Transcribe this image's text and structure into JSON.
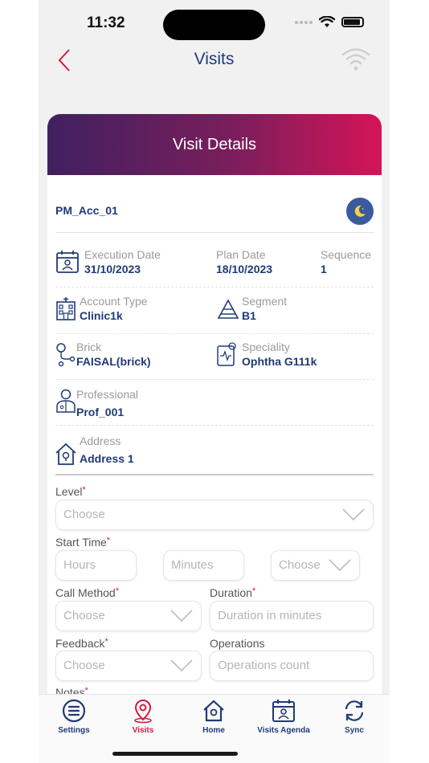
{
  "status": {
    "time": "11:32"
  },
  "nav": {
    "title": "Visits"
  },
  "card": {
    "header_title": "Visit Details",
    "account_name": "PM_Acc_01",
    "execution_date": {
      "label": "Execution Date",
      "value": "31/10/2023"
    },
    "plan_date": {
      "label": "Plan Date",
      "value": "18/10/2023"
    },
    "sequence": {
      "label": "Sequence",
      "value": "1"
    },
    "account_type": {
      "label": "Account Type",
      "value": "Clinic1k"
    },
    "segment": {
      "label": "Segment",
      "value": "B1"
    },
    "brick": {
      "label": "Brick",
      "value": "FAISAL(brick)"
    },
    "speciality": {
      "label": "Speciality",
      "value": "Ophtha G111k"
    },
    "professional": {
      "label": "Professional",
      "value": "Prof_001"
    },
    "address": {
      "label": "Address",
      "value": "Address 1"
    }
  },
  "form": {
    "required_mark": "*",
    "level": {
      "label": "Level",
      "placeholder": "Choose"
    },
    "start_time": {
      "label": "Start Time",
      "hours_placeholder": "Hours",
      "minutes_placeholder": "Minutes",
      "ampm_placeholder": "Choose"
    },
    "call_method": {
      "label": "Call Method",
      "placeholder": "Choose"
    },
    "duration": {
      "label": "Duration",
      "placeholder": "Duration in minutes"
    },
    "feedback": {
      "label": "Feedback",
      "placeholder": "Choose"
    },
    "operations": {
      "label": "Operations",
      "placeholder": "Operations count"
    },
    "notes": {
      "label": "Notes"
    }
  },
  "tabs": [
    {
      "label": "Settings",
      "icon": "settings-icon"
    },
    {
      "label": "Visits",
      "icon": "location-pin-icon",
      "active": true
    },
    {
      "label": "Home",
      "icon": "home-icon"
    },
    {
      "label": "Visits Agenda",
      "icon": "calendar-icon"
    },
    {
      "label": "Sync",
      "icon": "sync-icon"
    }
  ],
  "colors": {
    "navy": "#203a78",
    "accent": "#d7193e",
    "header_start": "#40205f",
    "header_end": "#d41457"
  }
}
